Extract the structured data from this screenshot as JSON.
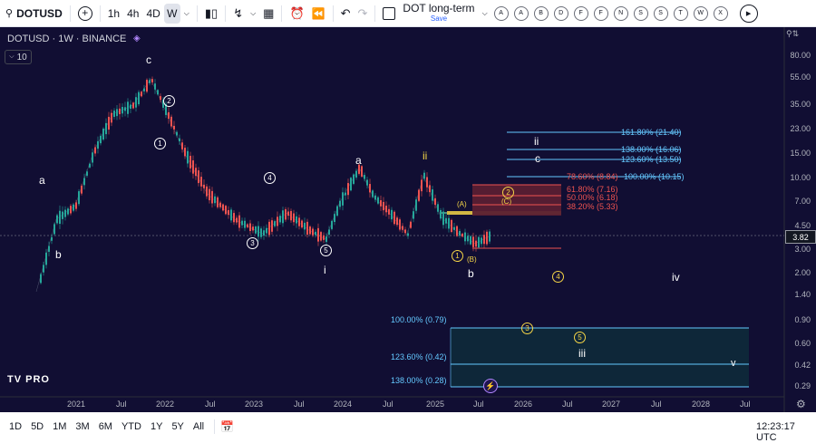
{
  "toolbar": {
    "symbol": "DOTUSD",
    "timeframes": [
      "1h",
      "4h",
      "4D",
      "W"
    ],
    "layout_name": "DOT long-term",
    "save_label": "Save",
    "alert_letters": [
      "A",
      "A",
      "B",
      "D",
      "F",
      "F",
      "N",
      "S",
      "S",
      "T",
      "W",
      "X"
    ]
  },
  "chart": {
    "title": "DOTUSD · 1W · BINANCE",
    "indicator_count": "10",
    "current_price": "3.82",
    "y_ticks": [
      "80.00",
      "55.00",
      "35.00",
      "23.00",
      "15.00",
      "10.00",
      "7.00",
      "4.50",
      "3.00",
      "2.00",
      "1.40",
      "0.90",
      "0.60",
      "0.42",
      "0.29"
    ],
    "x_ticks": [
      "2021",
      "Jul",
      "2022",
      "Jul",
      "2023",
      "Jul",
      "2024",
      "Jul",
      "2025",
      "Jul",
      "2026",
      "Jul",
      "2027",
      "Jul",
      "2028",
      "Jul"
    ],
    "fib_upper": [
      "161.80% (21.40)",
      "138.00% (16.06)",
      "123.60% (13.50)",
      "78.60% (8.84)",
      "100.00% (10.15)",
      "61.80% (7.16)",
      "50.00% (6.18)",
      "38.20% (5.33)"
    ],
    "fib_lower": [
      "100.00% (0.79)",
      "123.60% (0.42)",
      "138.00% (0.28)"
    ],
    "wave_labels": {
      "a1": "a",
      "b1": "b",
      "c1": "c",
      "i": "i",
      "a2": "a",
      "ii": "ii",
      "b2": "b",
      "c2": "c",
      "ii2": "ii",
      "iii": "iii",
      "iv": "iv",
      "v": "v"
    },
    "circled": {
      "c1": "1",
      "c2": "2",
      "c4": "4",
      "c3": "3",
      "c5": "5",
      "y1": "1",
      "y2": "2",
      "y3": "3",
      "y4": "4",
      "y5": "5"
    },
    "brackets": {
      "A": "(A)",
      "B": "(B)",
      "C": "(C)"
    },
    "logo": "TV PRO"
  },
  "bottom": {
    "ranges": [
      "1D",
      "5D",
      "1M",
      "3M",
      "6M",
      "YTD",
      "1Y",
      "5Y",
      "All"
    ],
    "clock": "12:23:17 UTC"
  },
  "colors": {
    "chart_bg": "#110e33",
    "up": "#26a69a",
    "down": "#ef5350",
    "fib_blue": "#64c8ff",
    "yellow": "#f5d547"
  }
}
